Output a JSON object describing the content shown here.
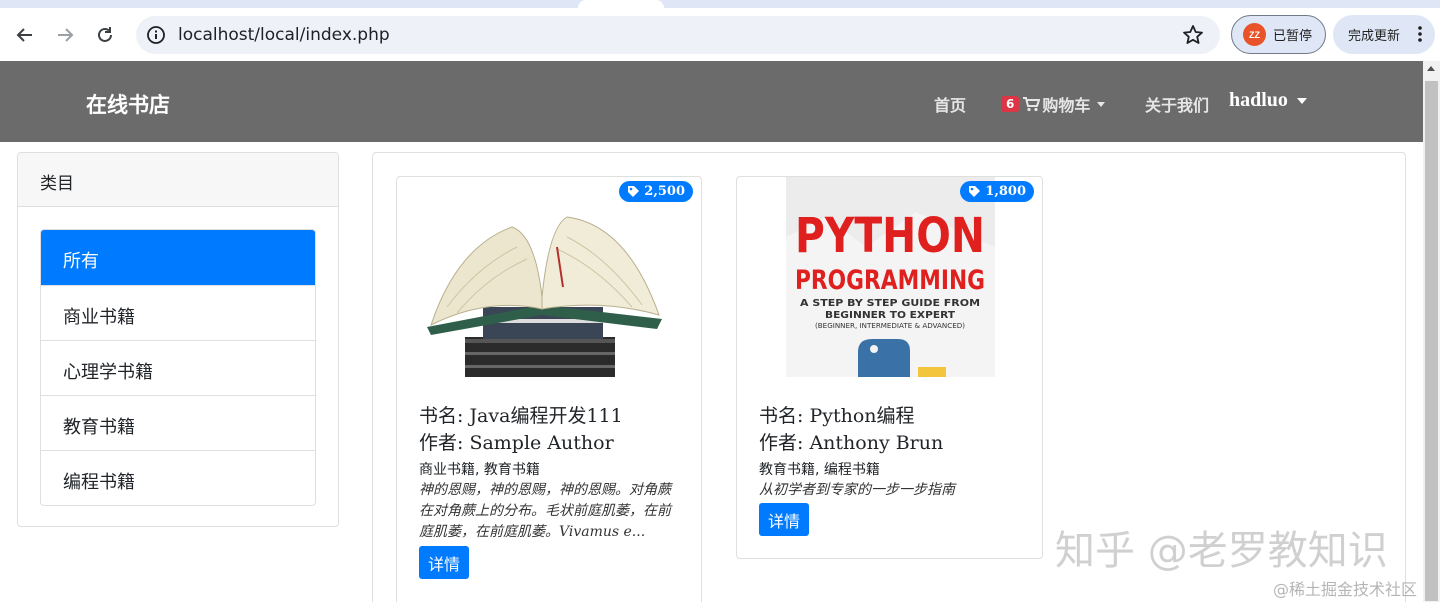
{
  "browser": {
    "url": "localhost/local/index.php",
    "profile_initials": "ZZ",
    "profile_label": "已暂停",
    "update_label": "完成更新"
  },
  "navbar": {
    "brand": "在线书店",
    "home": "首页",
    "cart_count": "6",
    "cart": "购物车",
    "about": "关于我们",
    "user": "hadluo"
  },
  "sidebar": {
    "title": "类目",
    "items": [
      {
        "label": "所有",
        "active": true
      },
      {
        "label": "商业书籍",
        "active": false
      },
      {
        "label": "心理学书籍",
        "active": false
      },
      {
        "label": "教育书籍",
        "active": false
      },
      {
        "label": "编程书籍",
        "active": false
      }
    ]
  },
  "books": [
    {
      "price": "2,500",
      "title_line": "书名: Java编程开发111",
      "author_line": "作者: Sample Author",
      "categories": "商业书籍, 教育书籍",
      "description": "神的恩赐，神的恩赐，神的恩赐。对角蕨在对角蕨上的分布。毛状前庭肌萎，在前庭肌萎，在前庭肌萎。Vivamus e...",
      "detail": "详情"
    },
    {
      "price": "1,800",
      "title_line": "书名: Python编程",
      "author_line": "作者: Anthony Brun",
      "categories": "教育书籍, 编程书籍",
      "description": "从初学者到专家的一步一步指南",
      "detail": "详情",
      "cover_text": {
        "line1": "PYTHON",
        "line2": "PROGRAMMING",
        "line3": "A STEP BY STEP GUIDE FROM",
        "line4": "BEGINNER TO EXPERT",
        "line5": "(BEGINNER, INTERMEDIATE & ADVANCED)"
      }
    }
  ],
  "watermarks": {
    "zhihu": "知乎 @老罗教知识",
    "juejin": "@稀土掘金技术社区"
  },
  "colors": {
    "primary": "#007bff",
    "navbar": "#6b6b6b",
    "badge_red": "#dc3545",
    "python_red": "#e0201f",
    "python_blue": "#3a72a8"
  }
}
